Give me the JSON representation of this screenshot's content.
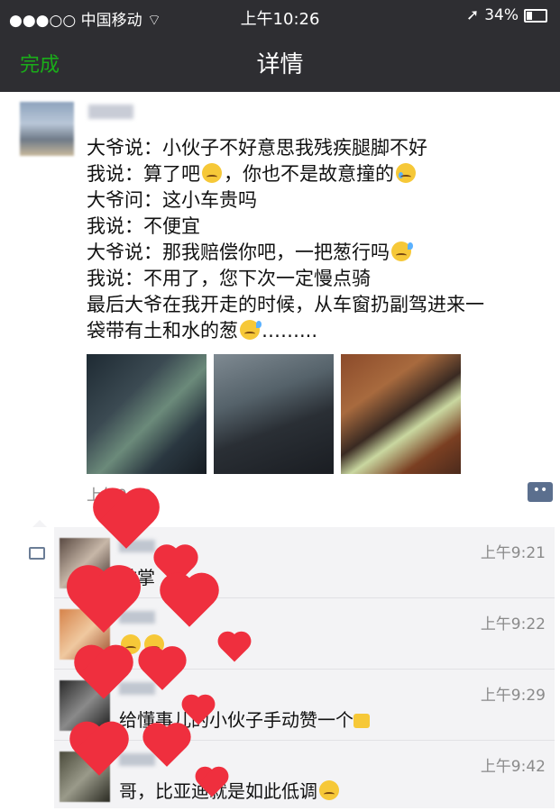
{
  "status_bar": {
    "carrier": "中国移动",
    "time": "上午10:26",
    "battery": "34%",
    "battery_level": 0.34
  },
  "nav": {
    "done_label": "完成",
    "title": "详情"
  },
  "post": {
    "lines": [
      "大爷说：小伙子不好意思我残疾腿脚不好",
      "我说：算了吧",
      "，你也不是故意撞的",
      "大爷问：这小车贵吗",
      "我说：不便宜",
      "大爷说：那我赔偿你吧，一把葱行吗",
      "我说：不用了，您下次一定慢点骑",
      "最后大爷在我开走的时候，从车窗扔副驾进来一",
      "袋带有土和水的葱",
      "……..."
    ],
    "time": "上午9:18"
  },
  "comments": [
    {
      "time": "上午9:21",
      "text": "鼓掌",
      "emoji_only": false
    },
    {
      "time": "上午9:22",
      "text": "",
      "emoji_only": true
    },
    {
      "time": "上午9:29",
      "text": "给懂事儿的小伙子手动赞一个",
      "emoji_only": false
    },
    {
      "time": "上午9:42",
      "text": "哥，比亚迪就是如此低调",
      "emoji_only": false
    }
  ],
  "colors": {
    "bar_bg": "#2e2e32",
    "accent_green": "#1aad19",
    "heart_red": "#ef2f3e",
    "comment_bg": "#f3f3f5"
  }
}
